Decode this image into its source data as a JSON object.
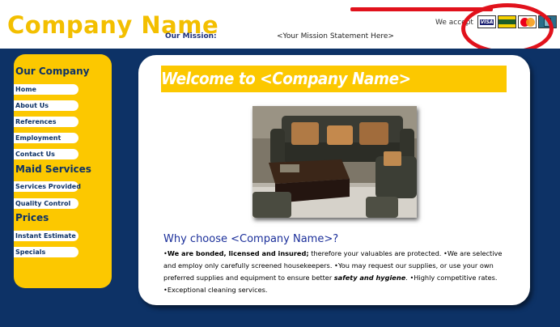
{
  "header": {
    "company_name": "Company Name",
    "mission_label": "Our Mission:",
    "mission_text": "<Your Mission Statement Here>",
    "accept_text": "We accept",
    "cards": [
      "VISA",
      "AMEX",
      "MasterCard",
      "Discover"
    ]
  },
  "sidebar": {
    "sections": [
      {
        "title": "Our Company",
        "items": [
          "Home",
          "About Us",
          "References",
          "Employment",
          "Contact Us"
        ]
      },
      {
        "title": "Maid Services",
        "items": [
          "Services Provided",
          "Quality Control"
        ]
      },
      {
        "title": "Prices",
        "items": [
          "Instant Estimate",
          "Specials"
        ]
      }
    ]
  },
  "main": {
    "welcome": "Welcome to <Company Name>",
    "why_title": "Why choose <Company Name>?",
    "body": {
      "p1_bold": "We are bonded, licensed and insured;",
      "p1_rest": " therefore your valuables are protected.",
      "p2": "We are selective and employ only carefully screened housekeepers.",
      "p3_start": "You may request our supplies, or use your own preferred supplies and equipment to ensure better ",
      "p3_emph": "safety and hygiene",
      "p3_end": ".",
      "p4": "Highly competitive rates.",
      "p5": "Exceptional cleaning services."
    }
  },
  "colors": {
    "brand_yellow": "#fcc800",
    "navy": "#0d3266",
    "annotation_red": "#e1121c"
  }
}
